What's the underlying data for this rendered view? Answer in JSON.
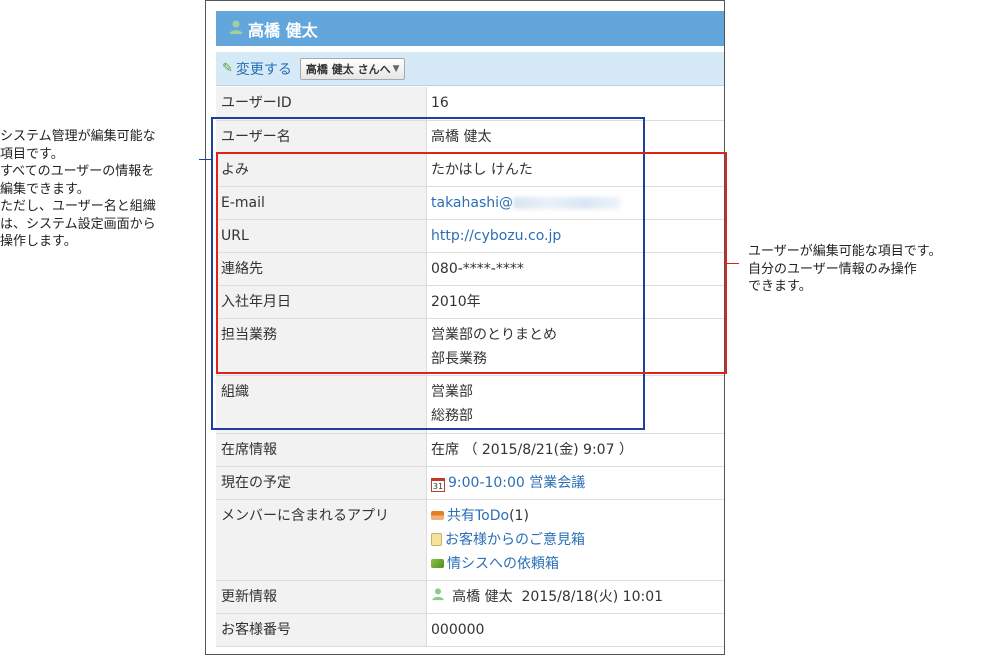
{
  "header": {
    "user_name": "高橋 健太",
    "icon": "user-icon"
  },
  "toolbar": {
    "edit_label": "変更する",
    "user_menu_label": "高橋 健太 さんへ"
  },
  "rows": [
    {
      "label": "ユーザーID",
      "values": [
        "16"
      ]
    },
    {
      "label": "ユーザー名",
      "values": [
        "高橋 健太"
      ]
    },
    {
      "label": "よみ",
      "values": [
        "たかはし けんた"
      ]
    },
    {
      "label": "E-mail",
      "values": [
        "takahashi@"
      ]
    },
    {
      "label": "URL",
      "values": [
        "http://cybozu.co.jp"
      ]
    },
    {
      "label": "連絡先",
      "values": [
        "080-****-****"
      ]
    },
    {
      "label": "入社年月日",
      "values": [
        "2010年"
      ]
    },
    {
      "label": "担当業務",
      "values": [
        "営業部のとりまとめ",
        "部長業務"
      ]
    },
    {
      "label": "組織",
      "values": [
        "営業部",
        "総務部"
      ]
    },
    {
      "label": "在席情報",
      "values": [
        "在席 （ 2015/8/21(金) 9:07 ）"
      ]
    },
    {
      "label": "現在の予定",
      "values": [
        "9:00-10:00 営業会議"
      ],
      "icon": "calendar-icon"
    },
    {
      "label": "メンバーに含まれるアプリ",
      "apps": [
        {
          "name": "共有ToDo",
          "count": "(1)",
          "icon": "todo-icon"
        },
        {
          "name": "お客様からのご意見箱",
          "icon": "note-icon"
        },
        {
          "name": "情シスへの依頼箱",
          "icon": "box-icon"
        }
      ]
    },
    {
      "label": "更新情報",
      "updater": "高橋 健太",
      "updated_at": "2015/8/18(火) 10:01"
    },
    {
      "label": "お客様番号",
      "values": [
        "000000"
      ]
    }
  ],
  "calendar_icon_text": "31",
  "annotations": {
    "left": [
      "システム管理が編集可能な",
      "項目です。",
      "すべてのユーザーの情報を",
      "編集できます。",
      "ただし、ユーザー名と組織",
      "は、システム設定画面から",
      "操作します。"
    ],
    "right": [
      "ユーザーが編集可能な項目です。",
      "自分のユーザー情報のみ操作",
      "できます。"
    ]
  },
  "colors": {
    "title_bar": "#63a6dc",
    "toolbar": "#d6e9f7",
    "link": "#2a6fb7",
    "admin_box": "#1f3f9a",
    "user_box": "#d9261c"
  }
}
